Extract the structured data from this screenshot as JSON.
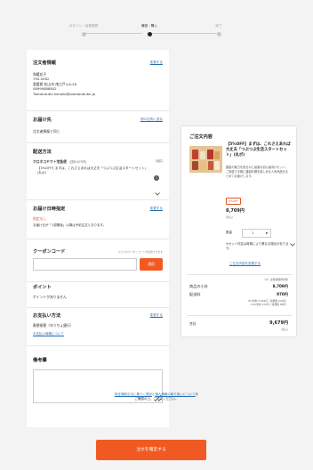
{
  "stepper": {
    "steps": [
      {
        "label": "ログイン・会員登録"
      },
      {
        "label": "確認・購入"
      },
      {
        "label": "完了"
      }
    ]
  },
  "edit_label": "変更する",
  "orderer": {
    "title": "注文者情報",
    "lines": [
      "和暖花子",
      "790-0062",
      "愛媛県 松山市 南江戸4-8-28",
      "08999888842",
      "Tububutubu.hanako@bububububu.jp"
    ]
  },
  "shipping_to": {
    "title": "お届け先",
    "link": "別の住所に送る",
    "text": "注文者情報と同じ"
  },
  "delivery_method": {
    "title": "配送方法",
    "carrier": "クロネコヤマト宅急便",
    "carrier_fee": "（送料:970円）",
    "carrier_count": "1個口",
    "item_text": "【5%OFF】まずは、これさえあれば大丈夫「つぶつぶ生活スタートセット」(丸ボ)",
    "item_qty": "1"
  },
  "delivery_date": {
    "title": "お届け日時指定",
    "value": "指定なし",
    "note": "お届け日が「1週間後」以降は予約注文となります。"
  },
  "coupon": {
    "title": "クーポンコード",
    "hint": "ひとつのクーポンコードが使用できます",
    "placeholder": "",
    "apply_label": "適用"
  },
  "points": {
    "title": "ポイント",
    "text": "ポイントがありません"
  },
  "payment": {
    "title": "お支払い方法",
    "method": "郵便振替（ゆうちょ銀行）",
    "link": "お支払い時期について"
  },
  "notes": {
    "title": "備考欄"
  },
  "order": {
    "title": "ご注文内容",
    "product_title": "【5%OFF】まずは、これさえあれば大丈夫「つぶつぶ生活スタートセット」(丸ボ)",
    "product_desc": "雑穀の魅力を知るのに最適な初心者向けセット。ご家庭で手軽に雑穀料理を楽しめる人気商品をまとめてお届けします。",
    "badge": "5%OFF",
    "price": "8,709円",
    "price_sub": "(税込)",
    "qty_label": "数量",
    "qty_value": "1",
    "note": "※セット内容は時期により異なる場合があります。",
    "coupon_link": "ご注文内容を変更する",
    "tax_note": "（※）は軽減税率対象",
    "subtotal_label": "商品の小計",
    "subtotal": "8,709円",
    "shipping_label": "配送料",
    "shipping": "970円",
    "tax_rows": [
      "8%対象 8,064円（消費税 645円）",
      "10%対象 970円（消費税 88円）"
    ],
    "total_label": "合計",
    "total": "9,679円",
    "total_sub": "(税込)"
  },
  "bottom": {
    "link1": "特定商取引法に基づく表記",
    "and": "と",
    "link2": "個人情報の取り扱いについて",
    "suffix": "を",
    "line2": "ご確認の上、ご注文ください。",
    "confirm_label": "注文を確定する"
  }
}
